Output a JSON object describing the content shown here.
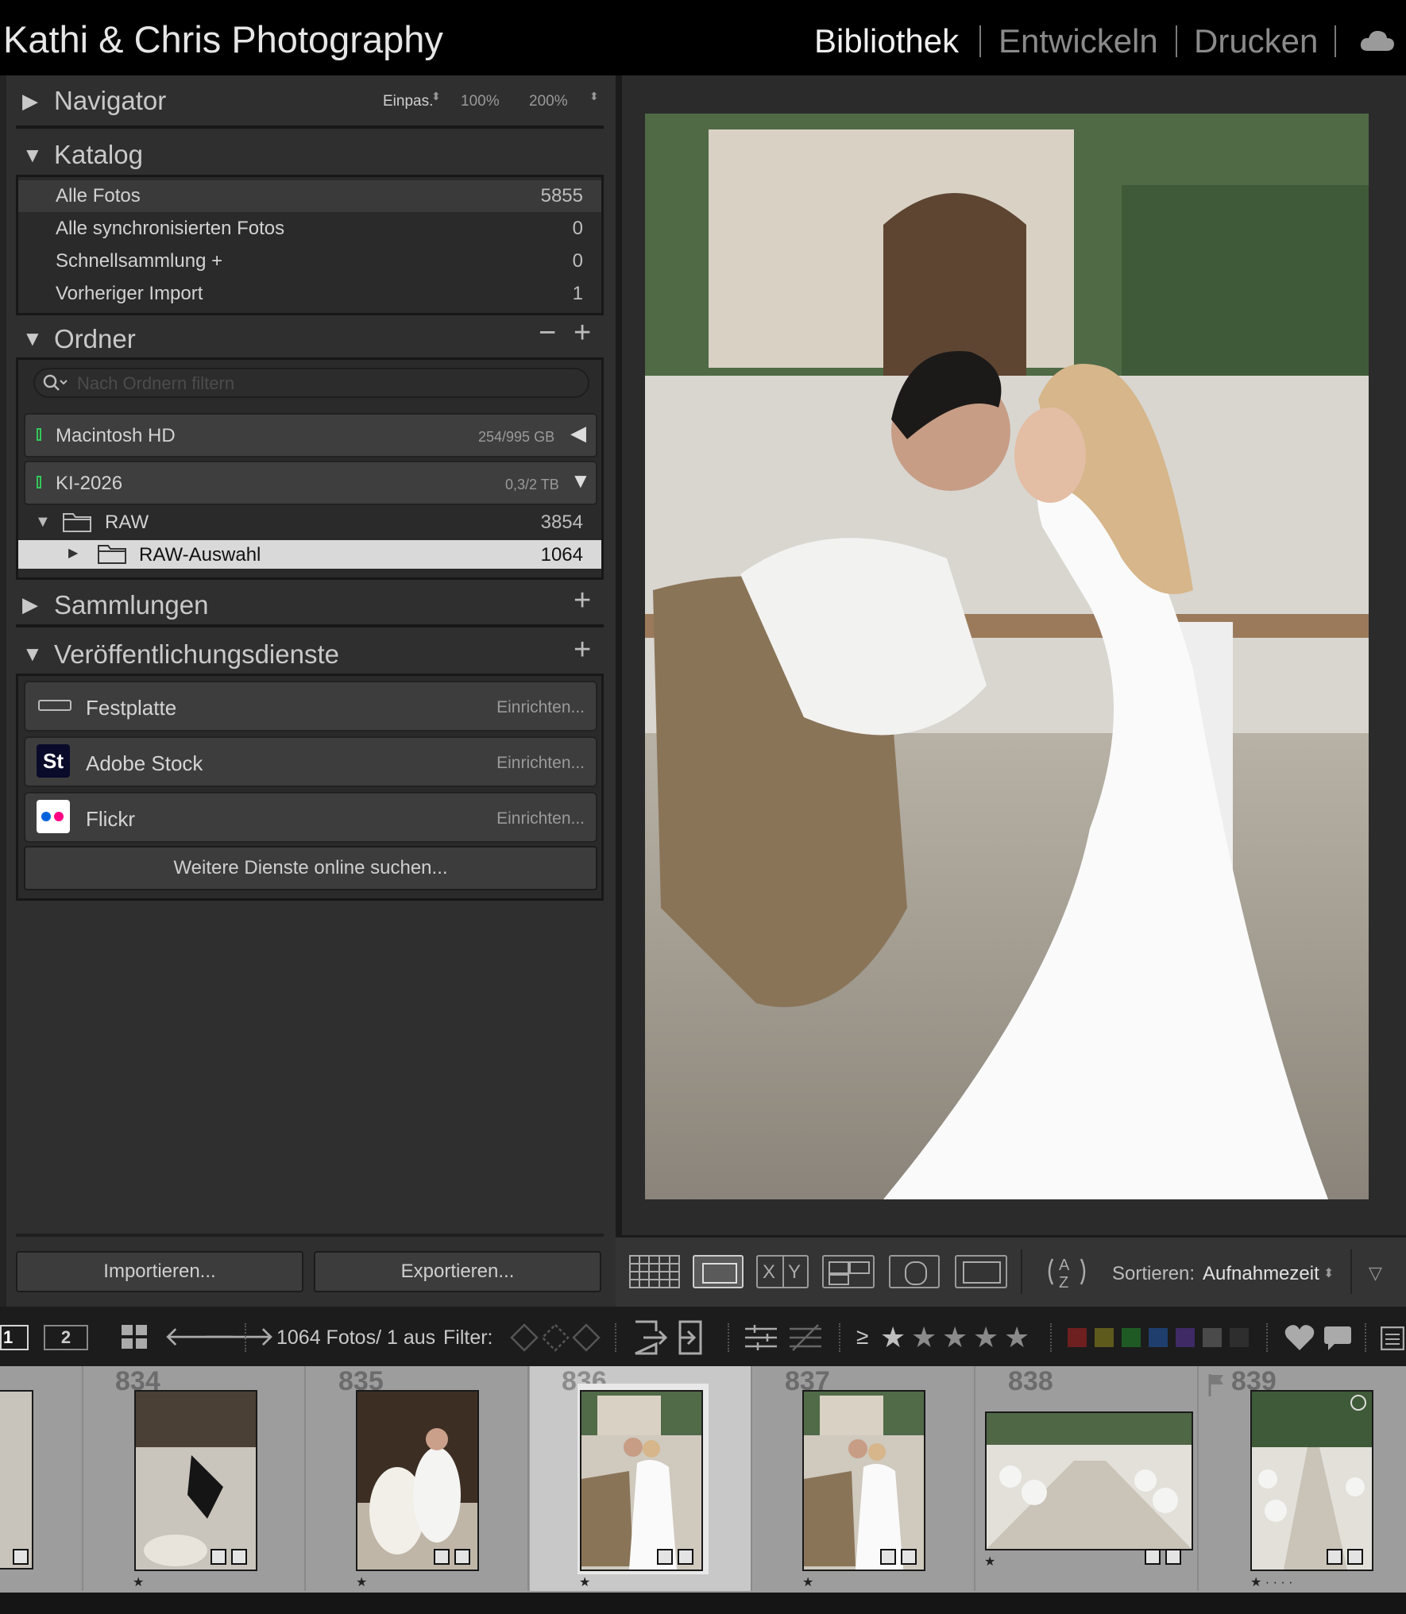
{
  "app_title": "Kathi & Chris Photography",
  "modules": {
    "library": "Bibliothek",
    "develop": "Entwickeln",
    "print": "Drucken"
  },
  "navigator": {
    "title": "Navigator",
    "fit": "Einpas.",
    "zoom1": "100%",
    "zoom2": "200%"
  },
  "catalog": {
    "title": "Katalog",
    "items": [
      {
        "label": "Alle Fotos",
        "count": "5855"
      },
      {
        "label": "Alle synchronisierten Fotos",
        "count": "0"
      },
      {
        "label": "Schnellsammlung  +",
        "count": "0"
      },
      {
        "label": "Vorheriger Import",
        "count": "1"
      }
    ]
  },
  "folders": {
    "title": "Ordner",
    "minus": "−",
    "plus": "+",
    "filter_placeholder": "Nach Ordnern filtern",
    "volumes": [
      {
        "name": "Macintosh HD",
        "size": "254/995 GB"
      },
      {
        "name": "KI-2026",
        "size": "0,3/2 TB"
      }
    ],
    "tree": [
      {
        "name": "RAW",
        "count": "3854"
      },
      {
        "name": "RAW-Auswahl",
        "count": "1064"
      }
    ]
  },
  "collections": {
    "title": "Sammlungen",
    "plus": "+"
  },
  "publish": {
    "title": "Veröffentlichungsdienste",
    "plus": "+",
    "services": [
      {
        "name": "Festplatte",
        "setup": "Einrichten..."
      },
      {
        "name": "Adobe Stock",
        "setup": "Einrichten...",
        "logo": "St"
      },
      {
        "name": "Flickr",
        "setup": "Einrichten..."
      }
    ],
    "more": "Weitere Dienste online suchen..."
  },
  "buttons": {
    "import": "Importieren...",
    "export": "Exportieren..."
  },
  "toolbar": {
    "sort_label": "Sortieren:",
    "sort_value": "Aufnahmezeit",
    "compare_x": "X",
    "compare_y": "Y",
    "az_icon": "sort-az-icon"
  },
  "filmbar": {
    "page1": "1",
    "page2": "2",
    "count_text": "1064 Fotos/ 1 aus",
    "filter_label": "Filter:",
    "gte": "≥"
  },
  "filmstrip": {
    "cells": [
      {
        "num": "834"
      },
      {
        "num": "835"
      },
      {
        "num": "836"
      },
      {
        "num": "837"
      },
      {
        "num": "838"
      },
      {
        "num": "839"
      }
    ]
  },
  "colors": {
    "label_red": "#6e1f1f",
    "label_yellow": "#5e5a1c",
    "label_green": "#1f5a25",
    "label_blue": "#1f3e6e",
    "label_purple": "#3f2a66",
    "label_gray1": "#4a4a4a",
    "label_gray2": "#2e2e2e",
    "flickr_pink": "#ff0084",
    "flickr_blue": "#0063dc",
    "volume_green": "#34c759"
  }
}
